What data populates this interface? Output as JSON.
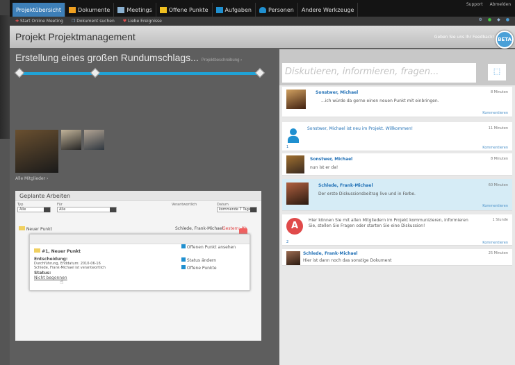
{
  "tabs": [
    "Projektübersicht",
    "Dokumente",
    "Meetings",
    "Offene Punkte",
    "Aufgaben",
    "Personen",
    "Andere Werkzeuge"
  ],
  "toplinks": {
    "support": "Support",
    "logout": "Abmelden"
  },
  "actions": [
    "Start Online Meeting",
    "Dokument suchen",
    "Liebe Ereignisse"
  ],
  "header": {
    "title": "Projekt Projektmanagement",
    "feedback": "Geben Sie uns Ihr Feedback!",
    "beta": "BETA"
  },
  "goal": {
    "text": "Erstellung eines großen Rundumschlags...",
    "link": "Projektbeschreibung ›"
  },
  "members": {
    "link": "Alle Mitglieder ›"
  },
  "work": {
    "title": "Geplante Arbeiten",
    "filters": [
      {
        "label": "Typ",
        "value": "Alle"
      },
      {
        "label": "Für",
        "value": "Alle"
      },
      {
        "label": "Verantwortlich",
        "value": ""
      },
      {
        "label": "Datum",
        "value": "kommende 7 Tage"
      }
    ],
    "rows": [
      {
        "title": "Neuer Punkt",
        "responsible": "Schlede, Frank-Michael",
        "date": "Gestern: 8h"
      }
    ]
  },
  "popup": {
    "title": "#1, Neuer Punkt",
    "decision_label": "Entscheidung:",
    "decision_text": "Durchführung, Enddatum: 2010-06-16",
    "responsible": "Schlede, Frank-Michael ist verantwortlich",
    "status_label": "Status:",
    "status_value": "Nicht begonnen",
    "actions": [
      "Offenen Punkt ansehen",
      "Status ändern",
      "Offene Punkte"
    ]
  },
  "discussion": {
    "placeholder": "Diskutieren, informieren, fragen..."
  },
  "feed": [
    {
      "author": "Sonstwer, Michael",
      "time": "8 Minuten",
      "text": "...ich würde da gerne einen neuen Punkt mit einbringen.",
      "comment": "Kommentieren"
    },
    {
      "text": "Sonstwer, Michael ist neu im Projekt. Willkommen!",
      "time": "11 Minuten",
      "count": "1",
      "comment": "Kommentieren"
    },
    {
      "author": "Sonstwer, Michael",
      "time": "8 Minuten",
      "text": "nun ist er da!"
    },
    {
      "author": "Schlede, Frank-Michael",
      "time": "60 Minuten",
      "text": "Der erste Diskussionsbeitrag live und in Farbe.",
      "comment": "Kommentieren"
    },
    {
      "text": "Hier können Sie mit allen Mitgliedern im Projekt kommunizieren, informieren Sie, stellen Sie Fragen oder starten Sie eine Diskussion!",
      "time": "1 Stunde",
      "count": "2",
      "comment": "Kommentieren"
    },
    {
      "author": "Schlede, Frank-Michael",
      "time": "25 Minuten",
      "text": "Hier ist dann noch das sonstige Dokument"
    }
  ]
}
